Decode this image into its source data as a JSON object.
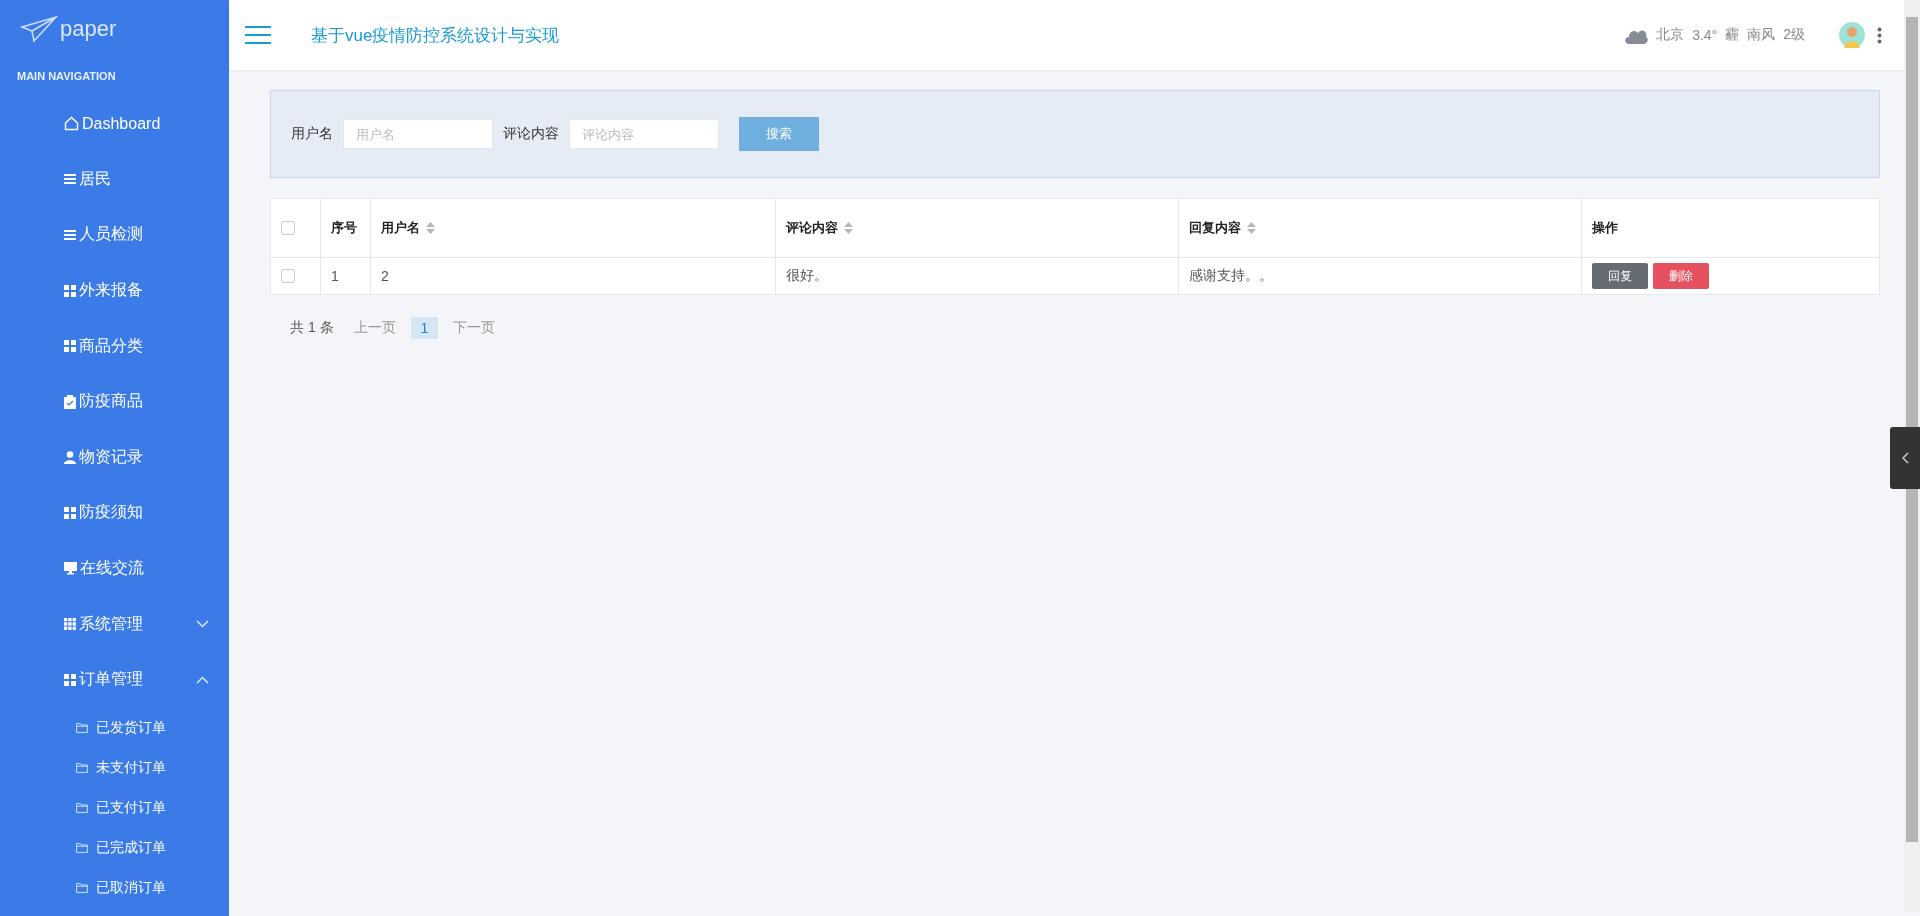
{
  "logo": {
    "text": "paper"
  },
  "nav_heading": "MAIN NAVIGATION",
  "sidebar": {
    "items": [
      {
        "label": "Dashboard",
        "kind": "home"
      },
      {
        "label": "居民",
        "kind": "list"
      },
      {
        "label": "人员检测",
        "kind": "list"
      },
      {
        "label": "外来报备",
        "kind": "grid"
      },
      {
        "label": "商品分类",
        "kind": "grid"
      },
      {
        "label": "防疫商品",
        "kind": "clipboard"
      },
      {
        "label": "物资记录",
        "kind": "user"
      },
      {
        "label": "防疫须知",
        "kind": "grid"
      },
      {
        "label": "在线交流",
        "kind": "monitor"
      },
      {
        "label": "系统管理",
        "kind": "grid9",
        "expanded": false
      },
      {
        "label": "订单管理",
        "kind": "grid",
        "expanded": true,
        "children": [
          {
            "label": "已发货订单"
          },
          {
            "label": "未支付订单"
          },
          {
            "label": "已支付订单"
          },
          {
            "label": "已完成订单"
          },
          {
            "label": "已取消订单"
          }
        ]
      }
    ]
  },
  "header": {
    "title": "基于vue疫情防控系统设计与实现",
    "weather": {
      "city": "北京",
      "temperature": "3.4°",
      "condition": "霾",
      "wind": "南风",
      "wind_level": "2级"
    }
  },
  "search": {
    "fields": [
      {
        "label": "用户名",
        "placeholder": "用户名"
      },
      {
        "label": "评论内容",
        "placeholder": "评论内容"
      }
    ],
    "button": "搜索"
  },
  "table": {
    "select_all_checked": false,
    "columns": [
      {
        "label": "序号",
        "sortable": false
      },
      {
        "label": "用户名",
        "sortable": true
      },
      {
        "label": "评论内容",
        "sortable": true
      },
      {
        "label": "回复内容",
        "sortable": true
      },
      {
        "label": "操作",
        "sortable": false
      }
    ],
    "rows": [
      {
        "checked": false,
        "cells": [
          "1",
          "2",
          "很好。",
          "感谢支持。。"
        ],
        "actions": [
          {
            "label": "回复",
            "kind": "reply"
          },
          {
            "label": "删除",
            "kind": "delete"
          }
        ]
      }
    ]
  },
  "pagination": {
    "total": "共 1 条",
    "prev": "上一页",
    "pages": [
      {
        "label": "1",
        "selected": true
      }
    ],
    "next": "下一页"
  }
}
